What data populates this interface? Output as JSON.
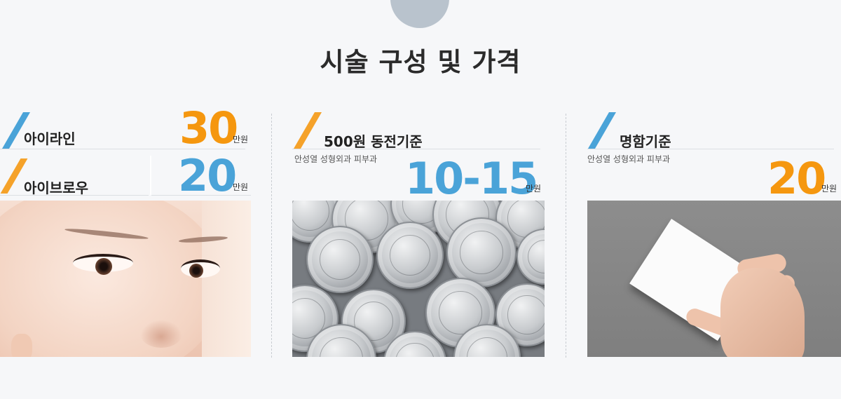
{
  "title": "시술 구성 및 가격",
  "columns": [
    {
      "rows": [
        {
          "label": "아이라인",
          "price": "30",
          "unit": "만원",
          "accent": "#4aa3d8",
          "price_color": "#f5970f"
        },
        {
          "label": "아이브로우",
          "price": "20",
          "unit": "만원",
          "accent": "#f5a22a",
          "price_color": "#4aa3d8"
        }
      ],
      "photo": "eye-closeup-photo"
    },
    {
      "label": "500원 동전기준",
      "subtext": "안성열 성형외과 피부과",
      "price": "10-15",
      "unit": "만원",
      "accent": "#f5a22a",
      "price_color": "#4aa3d8",
      "photo": "coins-photo"
    },
    {
      "label": "명함기준",
      "subtext": "안성열 성형외과 피부과",
      "price": "20",
      "unit": "만원",
      "accent": "#4aa3d8",
      "price_color": "#f5970f",
      "photo": "business-card-photo"
    }
  ]
}
